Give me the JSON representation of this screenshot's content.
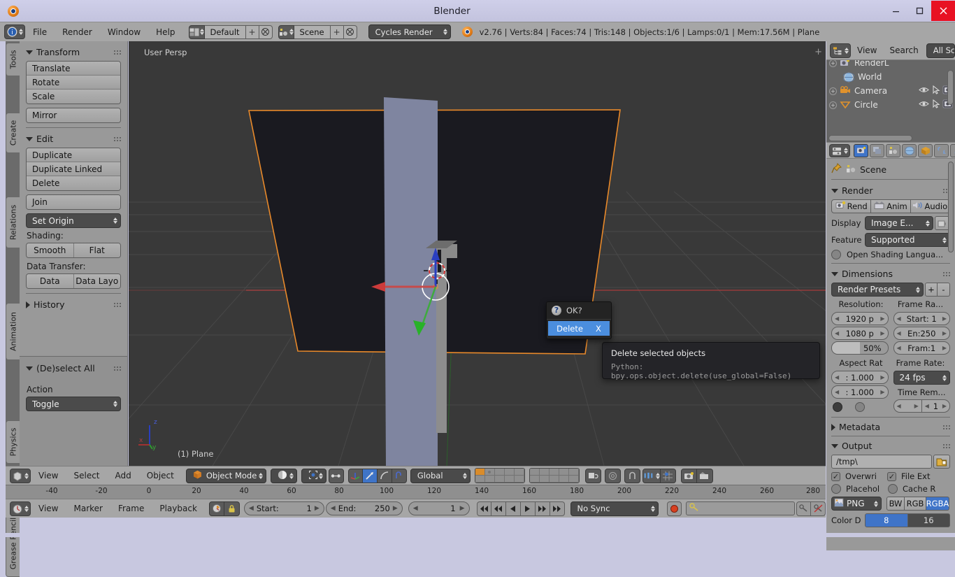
{
  "window": {
    "title": "Blender",
    "app_icon": "blender-logo-icon",
    "minimize": "minimize-icon",
    "maximize": "maximize-icon",
    "close": "close-icon"
  },
  "info_header": {
    "editor_type_icon": "info-editor-icon",
    "menus": [
      "File",
      "Render",
      "Window",
      "Help"
    ],
    "screen_layout": {
      "icon": "screen-layout-icon",
      "value": "Default",
      "add": "+",
      "remove": "x"
    },
    "scene": {
      "icon": "scene-icon",
      "value": "Scene",
      "add": "+",
      "remove": "x"
    },
    "render_engine": "Cycles Render",
    "status": "v2.76 | Verts:84 | Faces:74 | Tris:148 | Objects:1/6 | Lamps:0/1 | Mem:17.56M | Plane"
  },
  "toolshelf": {
    "tabs": [
      "Tools",
      "Create",
      "Relations",
      "Animation",
      "Physics",
      "Grease Pencil"
    ],
    "active_tab": "Tools",
    "panels": [
      {
        "title": "Transform",
        "open": true,
        "groups": [
          [
            "Translate",
            "Rotate",
            "Scale"
          ],
          [
            "Mirror"
          ]
        ]
      },
      {
        "title": "Edit",
        "open": true,
        "groups": [
          [
            "Duplicate",
            "Duplicate Linked",
            "Delete"
          ],
          [
            "Join"
          ]
        ],
        "set_origin": "Set Origin",
        "shading_label": "Shading:",
        "shading_buttons": [
          "Smooth",
          "Flat"
        ],
        "data_transfer_label": "Data Transfer:",
        "data_transfer_buttons": [
          "Data",
          "Data Layo"
        ]
      },
      {
        "title": "History",
        "open": false
      }
    ],
    "operator_panel": {
      "title": "(De)select All",
      "action_label": "Action",
      "action_value": "Toggle"
    }
  },
  "viewport": {
    "view_label": "User Persp",
    "object_label": "(1) Plane",
    "axis_gizmo": {
      "x": "x",
      "y": "y",
      "z": "z"
    },
    "colors": {
      "background": "#393939",
      "selected_outline": "#e8892a",
      "plane_fill": "#1a1a20",
      "wall_fill": "#7f85a0",
      "axis_x": "#c64b4b",
      "axis_y": "#4aa04a",
      "axis_z": "#2a3fc0"
    }
  },
  "view3d_header": {
    "editor_icon": "view3d-editor-icon",
    "menus": [
      "View",
      "Select",
      "Add",
      "Object"
    ],
    "mode": {
      "icon": "object-mode-icon",
      "value": "Object Mode"
    },
    "shading": "shading-solid-icon",
    "pivot": "pivot-median-icon",
    "proportional": "proportional-edit-icon",
    "manipulators": [
      "translate-manip-icon",
      "rotate-manip-icon",
      "scale-manip-icon"
    ],
    "transform_orientation": "Global",
    "layers_label": "scene-layers-grid",
    "extra_icons": [
      "lock-camera-icon",
      "render-only-icon",
      "snap-magnet-icon",
      "snap-target-icon",
      "snap-element-icon",
      "render-view-icon",
      "render-anim-icon"
    ]
  },
  "timeline": {
    "editor_icon": "timeline-editor-icon",
    "menus": [
      "View",
      "Marker",
      "Frame",
      "Playback"
    ],
    "toggles": [
      "auto-keyframe-icon",
      "lock-icon"
    ],
    "start": {
      "label": "Start:",
      "value": "1"
    },
    "end": {
      "label": "End:",
      "value": "250"
    },
    "current_frame": "1",
    "playback_buttons": [
      "jump-start-icon",
      "step-back-icon",
      "play-reverse-icon",
      "play-icon",
      "step-forward-icon",
      "jump-end-icon"
    ],
    "sync_mode": "No Sync",
    "record": "record-icon",
    "keying_set": {
      "icon": "keyframe-icon",
      "value": ""
    },
    "keying_add": "add-keyframe-icon",
    "keying_remove": "remove-keyframe-icon",
    "ruler_ticks": [
      "-40",
      "-20",
      "0",
      "20",
      "40",
      "60",
      "80",
      "100",
      "120",
      "140",
      "160",
      "180",
      "200",
      "220",
      "240",
      "260",
      "280"
    ],
    "playhead_frame": "1"
  },
  "outliner": {
    "editor_icon": "outliner-editor-icon",
    "menus": [
      "View",
      "Search"
    ],
    "display_mode": "All Sc",
    "rows": [
      {
        "name": "RenderL",
        "icon": "renderlayer-icon",
        "expandable": true,
        "restrict": []
      },
      {
        "name": "World",
        "icon": "world-icon",
        "expandable": false,
        "restrict": []
      },
      {
        "name": "Camera",
        "icon": "camera-icon",
        "expandable": true,
        "restrict": [
          "eye-icon",
          "cursor-icon",
          "camera-render-icon"
        ]
      },
      {
        "name": "Circle",
        "icon": "mesh-circle-icon",
        "expandable": true,
        "restrict": [
          "eye-icon",
          "cursor-icon",
          "camera-render-icon"
        ]
      }
    ]
  },
  "properties": {
    "editor_icon": "properties-editor-icon",
    "tabs": [
      "render-tab-icon",
      "renderlayers-tab-icon",
      "scene-tab-icon",
      "world-tab-icon",
      "object-tab-icon",
      "constraints-tab-icon",
      "modifiers-tab-icon"
    ],
    "active_tab": "render-tab-icon",
    "breadcrumb": {
      "pin": "pin-icon",
      "icon": "scene-icon",
      "label": "Scene"
    },
    "render_panel": {
      "title": "Render",
      "buttons": [
        {
          "label": "Rend",
          "icon": "render-still-icon"
        },
        {
          "label": "Anim",
          "icon": "render-anim-icon"
        },
        {
          "label": "Audio",
          "icon": "render-audio-icon"
        }
      ],
      "display_label": "Display",
      "display_value": "Image E...",
      "display_lock": "lock-icon",
      "feature_label": "Feature",
      "feature_value": "Supported",
      "osl_label": "Open Shading Langua...",
      "osl_checked": false
    },
    "dimensions_panel": {
      "title": "Dimensions",
      "presets": "Render Presets",
      "preset_add": "+",
      "preset_remove": "-",
      "resolution_label": "Resolution:",
      "resolution_x": "1920 p",
      "resolution_y": "1080 p",
      "resolution_percent": "50%",
      "frame_range_label": "Frame Ra...",
      "frame_start": "Start: 1",
      "frame_end": "En:250",
      "frame_step": "Fram:1",
      "aspect_label": "Aspect Rat",
      "aspect_x": ": 1.000",
      "aspect_y": ": 1.000",
      "frame_rate_label": "Frame Rate:",
      "frame_rate": "24 fps",
      "time_remap_label": "Time Rem...",
      "time_remap_old": "",
      "time_remap_new": "1",
      "border_checked": false,
      "crop_checked": false
    },
    "metadata_panel": {
      "title": "Metadata",
      "open": false
    },
    "output_panel": {
      "title": "Output",
      "path": "/tmp\\",
      "browse": "folder-icon",
      "overwrite_label": "Overwri",
      "overwrite_checked": true,
      "file_ext_label": "File Ext",
      "file_ext_checked": true,
      "placeholder_label": "Placehol",
      "placeholder_checked": false,
      "cache_label": "Cache R",
      "cache_checked": false,
      "format": "PNG",
      "format_icon": "image-file-icon",
      "color_modes": [
        "BW",
        "RGB",
        "RGBA"
      ],
      "color_mode_active": "RGBA",
      "color_depth_label": "Color D",
      "color_depths": [
        "8",
        "16"
      ],
      "color_depth_active": "8"
    }
  },
  "popup": {
    "header": "OK?",
    "header_icon": "question-icon",
    "item_label": "Delete",
    "item_underline": "D",
    "item_shortcut": "X",
    "highlight_color": "#4b8ede"
  },
  "tooltip": {
    "title": "Delete selected objects",
    "python": "Python: bpy.ops.object.delete(use_global=False)"
  }
}
